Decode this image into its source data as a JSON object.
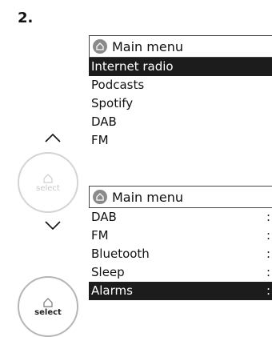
{
  "step_number": "2.",
  "knobs": {
    "upper_label": "select",
    "lower_label": "select"
  },
  "menu_top": {
    "title": "Main menu",
    "items": [
      {
        "label": "Internet radio",
        "selected": true
      },
      {
        "label": "Podcasts",
        "selected": false
      },
      {
        "label": "Spotify",
        "selected": false
      },
      {
        "label": "DAB",
        "selected": false
      },
      {
        "label": "FM",
        "selected": false
      }
    ]
  },
  "menu_bottom": {
    "title": "Main menu",
    "items": [
      {
        "label": "DAB",
        "suffix": ":",
        "selected": false
      },
      {
        "label": "FM",
        "suffix": ":",
        "selected": false
      },
      {
        "label": "Bluetooth",
        "suffix": ":",
        "selected": false
      },
      {
        "label": "Sleep",
        "suffix": ":",
        "selected": false
      },
      {
        "label": "Alarms",
        "suffix": ":",
        "selected": true
      }
    ]
  },
  "icons": {
    "up": "chevron-up-icon",
    "down": "chevron-down-icon",
    "home": "home-icon"
  },
  "colors": {
    "selection_bg": "#1c1c1c",
    "icon_gray": "#8a8a8a",
    "knob_border": "#b5b5b5"
  }
}
